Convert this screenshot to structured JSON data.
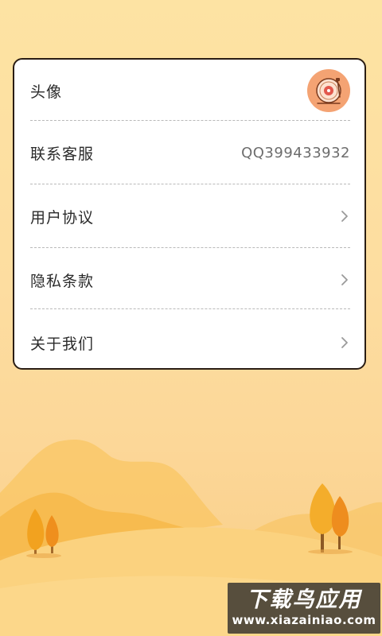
{
  "settings": {
    "avatar": {
      "label": "头像"
    },
    "customer_service": {
      "label": "联系客服",
      "value": "QQ399433932"
    },
    "user_agreement": {
      "label": "用户协议"
    },
    "privacy_policy": {
      "label": "隐私条款"
    },
    "about_us": {
      "label": "关于我们"
    }
  },
  "watermark": {
    "logo": "下载鸟应用",
    "url": "www.xiazainiao.com"
  },
  "colors": {
    "background": "#fde3a3",
    "card_border": "#2a1d14",
    "hills": "#f6b94a",
    "trees": "#f2a21f",
    "avatar": "#f4a373"
  },
  "icons": {
    "avatar": "vinyl-record-icon",
    "row_arrow": "chevron-right-icon"
  }
}
